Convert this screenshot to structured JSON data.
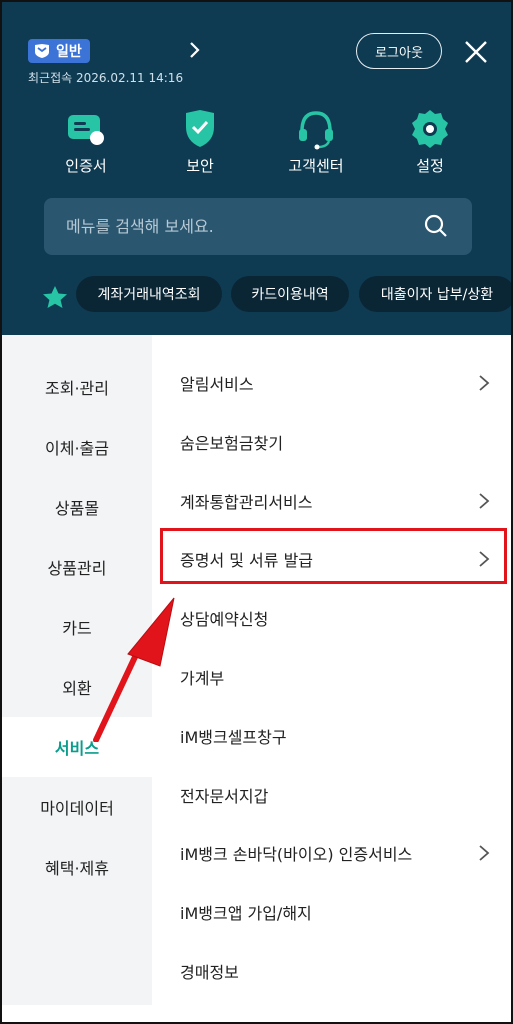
{
  "header": {
    "grade_badge": "일반",
    "last_login": "최근접속 2026.02.11 14:16",
    "logout_label": "로그아웃"
  },
  "quick_menu": [
    {
      "label": "인증서",
      "icon": "certificate-icon"
    },
    {
      "label": "보안",
      "icon": "shield-check-icon"
    },
    {
      "label": "고객센터",
      "icon": "headset-icon"
    },
    {
      "label": "설정",
      "icon": "gear-icon"
    }
  ],
  "search": {
    "placeholder": "메뉴를 검색해 보세요."
  },
  "favorites": [
    {
      "label": "계좌거래내역조회"
    },
    {
      "label": "카드이용내역"
    },
    {
      "label": "대출이자 납부/상환"
    }
  ],
  "sidebar": {
    "items": [
      {
        "label": "조회·관리"
      },
      {
        "label": "이체·출금"
      },
      {
        "label": "상품몰"
      },
      {
        "label": "상품관리"
      },
      {
        "label": "카드"
      },
      {
        "label": "외환"
      },
      {
        "label": "서비스",
        "active": true
      },
      {
        "label": "마이데이터"
      },
      {
        "label": "혜택·제휴"
      }
    ]
  },
  "menu": {
    "items": [
      {
        "label": "알림서비스",
        "has_submenu": true
      },
      {
        "label": "숨은보험금찾기",
        "has_submenu": false
      },
      {
        "label": "계좌통합관리서비스",
        "has_submenu": true
      },
      {
        "label": "증명서 및 서류 발급",
        "has_submenu": true,
        "highlighted": true
      },
      {
        "label": "상담예약신청",
        "has_submenu": false
      },
      {
        "label": "가계부",
        "has_submenu": false
      },
      {
        "label": "iM뱅크셀프창구",
        "has_submenu": false
      },
      {
        "label": "전자문서지갑",
        "has_submenu": false
      },
      {
        "label": "iM뱅크 손바닥(바이오) 인증서비스",
        "has_submenu": true
      },
      {
        "label": "iM뱅크앱 가입/해지",
        "has_submenu": false
      },
      {
        "label": "경매정보",
        "has_submenu": false
      }
    ]
  },
  "colors": {
    "header_bg": "#0f3b52",
    "accent_teal": "#0b9c8c",
    "annotation_red": "#e0141a"
  }
}
